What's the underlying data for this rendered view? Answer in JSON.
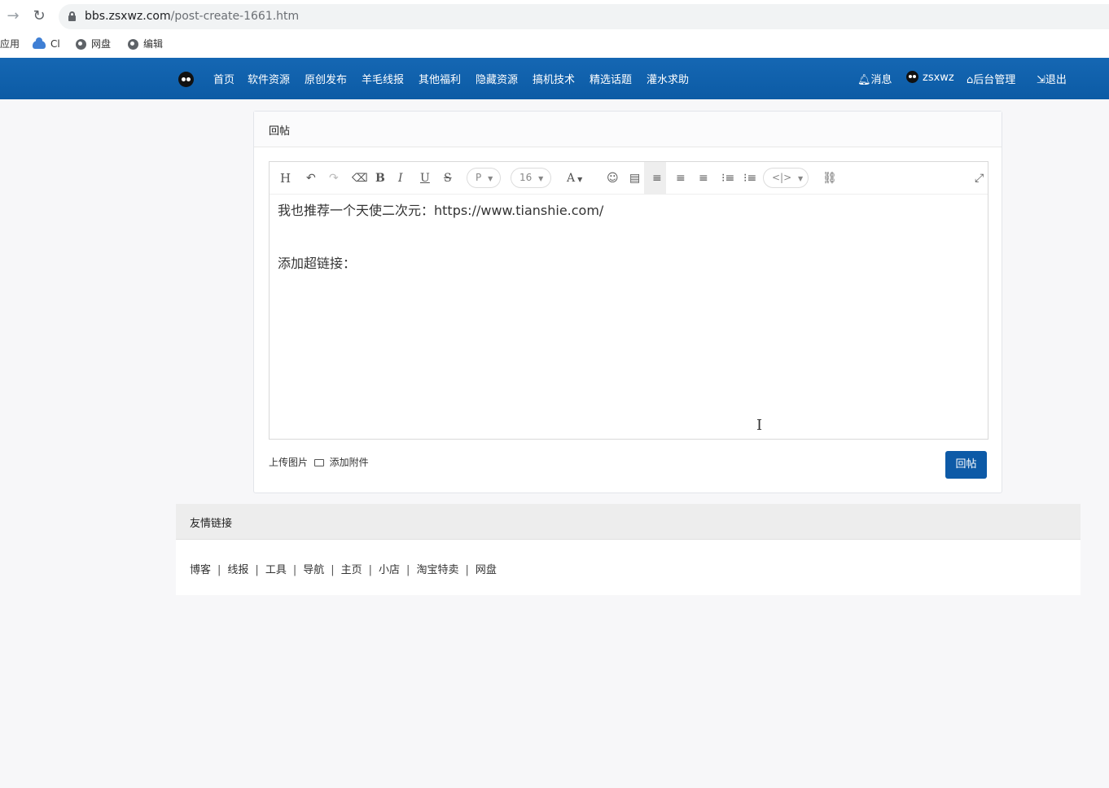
{
  "browser": {
    "back_icon": "arrow-right-icon",
    "reload_icon": "reload-icon",
    "url_host": "bbs.zsxwz.com",
    "url_path": "/post-create-1661.htm",
    "bookmarks": [
      {
        "label": "应用",
        "icon": "none"
      },
      {
        "label": "Cl",
        "icon": "cloud-icon"
      },
      {
        "label": "网盘",
        "icon": "globe-icon"
      },
      {
        "label": "编辑",
        "icon": "globe-icon"
      }
    ]
  },
  "nav": {
    "items": [
      "首页",
      "软件资源",
      "原创发布",
      "羊毛线报",
      "其他福利",
      "隐藏资源",
      "搞机技术",
      "精选话题",
      "灌水求助"
    ],
    "messages": "消息",
    "user": "zsxwz",
    "admin": "后台管理",
    "logout": "退出",
    "accent": "#0c5ba5"
  },
  "reply": {
    "title": "回帖",
    "toolbar": {
      "heading": "H",
      "bold": "B",
      "italic": "I",
      "underline": "U",
      "strike": "S",
      "paragraph": "P",
      "font_size": "16",
      "font_color": "A",
      "code": "<|>"
    },
    "content": [
      "我也推荐一个天使二次元：https://www.tianshie.com/",
      "添加超链接："
    ],
    "upload_image": "上传图片",
    "add_attachment": "添加附件",
    "submit": "回帖",
    "submit_color": "#0d5aa7"
  },
  "links": {
    "title": "友情链接",
    "items": [
      "博客",
      "线报",
      "工具",
      "导航",
      "主页",
      "小店",
      "淘宝特卖",
      "网盘"
    ],
    "separator": "|"
  }
}
